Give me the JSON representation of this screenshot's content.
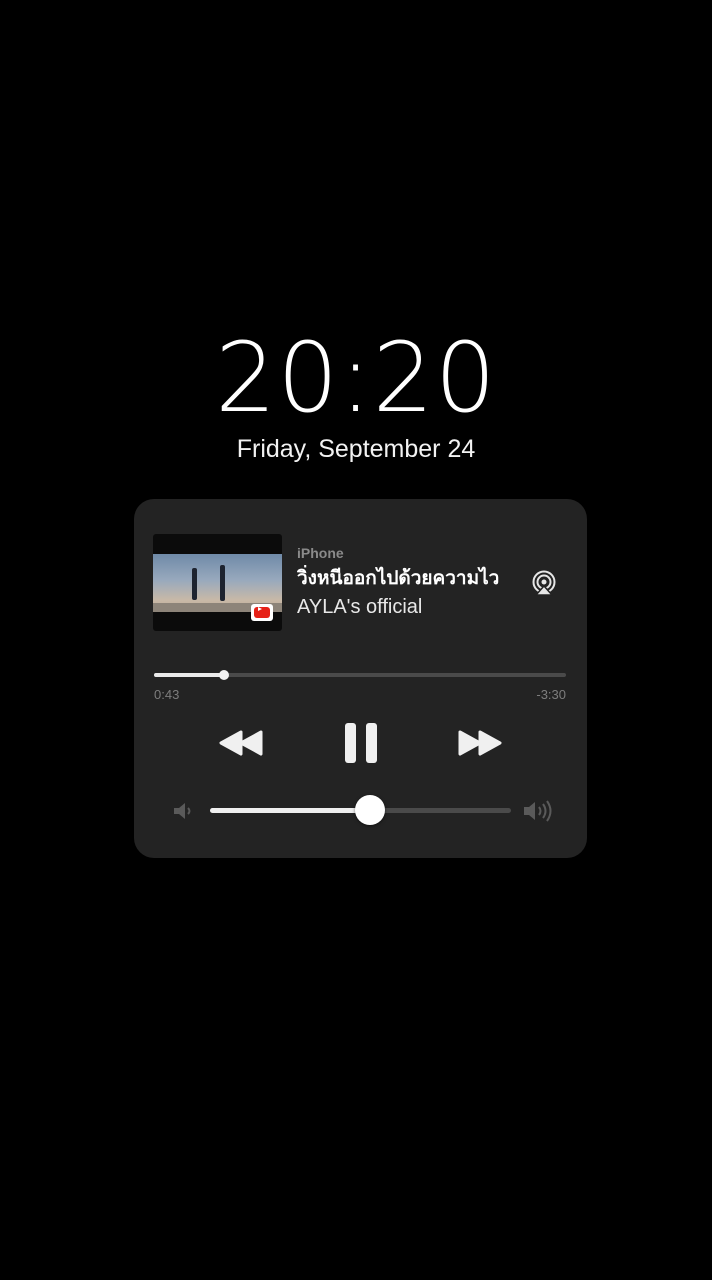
{
  "lock_screen": {
    "time": "20:20",
    "date": "Friday, September 24"
  },
  "now_playing": {
    "source": "iPhone",
    "title": "วิ่งหนีออกไปด้วยความไว",
    "artist": "AYLA's official",
    "artwork_icon": "youtube-icon",
    "elapsed": "0:43",
    "remaining": "-3:30",
    "progress_fraction": 0.17,
    "volume_fraction": 0.53,
    "icons": {
      "airplay": "airplay-icon",
      "rewind": "rewind-icon",
      "pause": "pause-icon",
      "forward": "fast-forward-icon",
      "volume_low": "volume-low-icon",
      "volume_high": "volume-high-icon"
    }
  },
  "colors": {
    "background": "#000000",
    "card": "#232323",
    "accent_youtube": "#e62117"
  }
}
